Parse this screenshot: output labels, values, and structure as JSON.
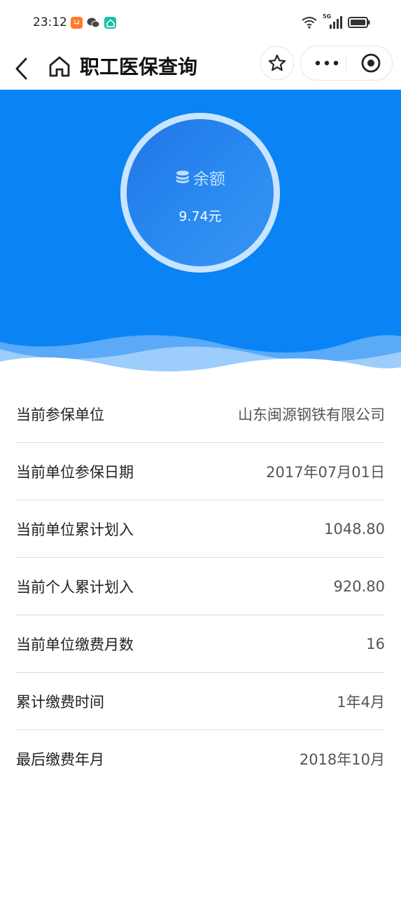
{
  "status_bar": {
    "time": "23:12",
    "network": "5G",
    "icons": [
      "taobao-app-icon",
      "wechat-icon",
      "home-app-icon",
      "wifi-icon",
      "signal-icon",
      "battery-icon"
    ]
  },
  "nav": {
    "title": "职工医保查询",
    "icons": [
      "back-icon",
      "home-icon",
      "star-icon",
      "more-icon",
      "target-icon"
    ]
  },
  "balance": {
    "label": "余额",
    "value": "9.74元"
  },
  "info_rows": [
    {
      "label": "当前参保单位",
      "value": "山东闽源钢铁有限公司"
    },
    {
      "label": "当前单位参保日期",
      "value": "2017年07月01日"
    },
    {
      "label": "当前单位累计划入",
      "value": "1048.80"
    },
    {
      "label": "当前个人累计划入",
      "value": "920.80"
    },
    {
      "label": "当前单位缴费月数",
      "value": "16"
    },
    {
      "label": "累计缴费时间",
      "value": "1年4月"
    },
    {
      "label": "最后缴费年月",
      "value": "2018年10月"
    }
  ],
  "colors": {
    "hero_blue": "#0a84f5",
    "ring": "#c9e4ff",
    "circle": "#2a8cf2"
  }
}
